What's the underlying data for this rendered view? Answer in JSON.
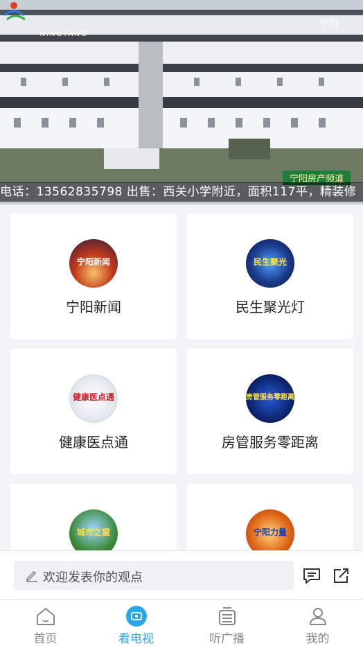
{
  "video": {
    "ticker": "电话：13562835798   出售：西关小学附近，面积117平，精装修",
    "ribbon": "宁阳房产频道",
    "logo_text": "NINGYANG",
    "corner_mark": "宁阳"
  },
  "channels": [
    {
      "label": "宁阳新闻",
      "thumb_text": "宁阳新闻",
      "thumb_color": "#c33a1c"
    },
    {
      "label": "民生聚光灯",
      "thumb_text": "民生聚光",
      "thumb_color": "#1b3a8a"
    },
    {
      "label": "健康医点通",
      "thumb_text": "健康医点通",
      "thumb_color": "#e4e9ef"
    },
    {
      "label": "房管服务零距离",
      "thumb_text": "房管服务零距离",
      "thumb_color": "#0f2a7a"
    },
    {
      "label": "",
      "thumb_text": "城市之窗",
      "thumb_color": "#3c8a3a"
    },
    {
      "label": "",
      "thumb_text": "宁阳力量",
      "thumb_color": "#e06a1a"
    }
  ],
  "comment": {
    "placeholder": "欢迎发表你的观点"
  },
  "nav": [
    {
      "label": "首页",
      "icon": "home-icon",
      "active": false
    },
    {
      "label": "看电视",
      "icon": "tv-icon",
      "active": true
    },
    {
      "label": "听广播",
      "icon": "radio-icon",
      "active": false
    },
    {
      "label": "我的",
      "icon": "user-icon",
      "active": false
    }
  ],
  "colors": {
    "accent": "#2aa6e8",
    "background": "#f3f4f6"
  }
}
